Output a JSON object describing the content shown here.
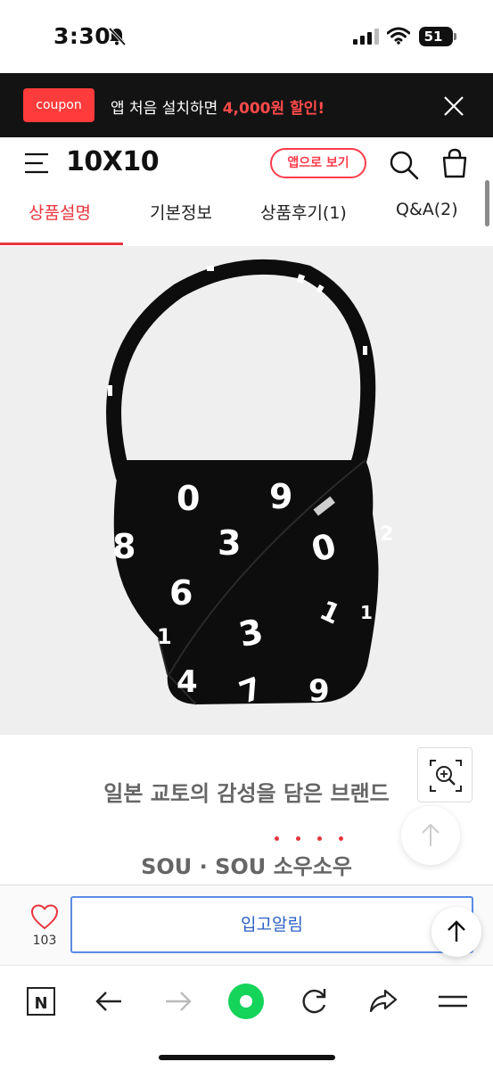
{
  "status_bar": {
    "time": "3:30",
    "battery_level": "51",
    "icons": [
      "bell-slash-icon",
      "cell-signal-icon",
      "wifi-icon",
      "battery-icon"
    ]
  },
  "banner": {
    "coupon_label": "coupon",
    "text_before": "앱 처음 설치하면 ",
    "text_highlight": "4,000원 할인!",
    "highlight_color": "#ff4a4a"
  },
  "header": {
    "logo": "10X10",
    "app_button": "앱으로 보기",
    "accent_color": "#e8353e"
  },
  "tabs": [
    {
      "label": "상품설명",
      "active": true
    },
    {
      "label": "기본정보",
      "active": false
    },
    {
      "label": "상품후기(1)",
      "active": false
    },
    {
      "label": "Q&A(2)",
      "active": false
    }
  ],
  "product": {
    "description_title": "일본 교토의 감성을 담은 브랜드",
    "description_brand": "SOU · SOU 소우소우"
  },
  "action_bar": {
    "like_count": "103",
    "notify_button": "입고알림"
  }
}
